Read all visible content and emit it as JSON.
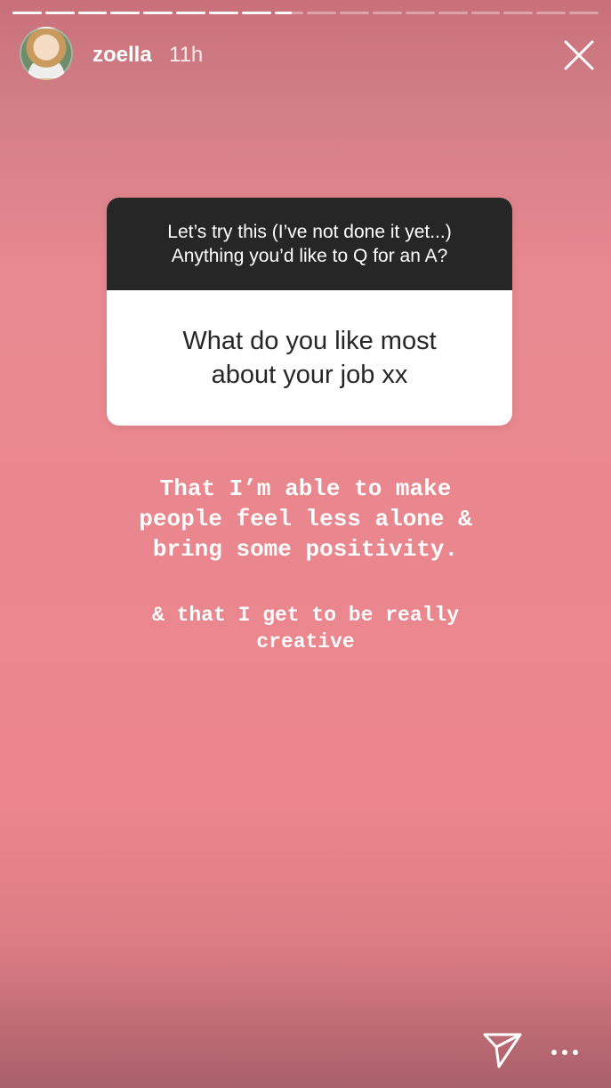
{
  "story": {
    "progress": {
      "segments_total": 18,
      "segments_viewed": 8,
      "current_segment_progress": 0.6
    },
    "user": {
      "username": "zoella",
      "time_ago": "11h"
    },
    "question_sticker": {
      "prompt_lines": [
        "Let’s try this (I’ve not done it yet...)",
        "Anything you’d like to Q for an A?"
      ],
      "answer_lines": [
        "What do you like most",
        "about your job xx"
      ]
    },
    "typed_text": {
      "block1": [
        "That I’m able to make",
        "people feel less alone &",
        "bring some positivity."
      ],
      "block2": [
        "& that I get to be really",
        "creative"
      ]
    }
  },
  "icons": {
    "close": "close-icon",
    "send": "paper-plane-icon",
    "more": "more-dots-icon"
  },
  "colors": {
    "background": "#ec868c",
    "sticker_header": "#262626",
    "text": "#ffffff"
  }
}
